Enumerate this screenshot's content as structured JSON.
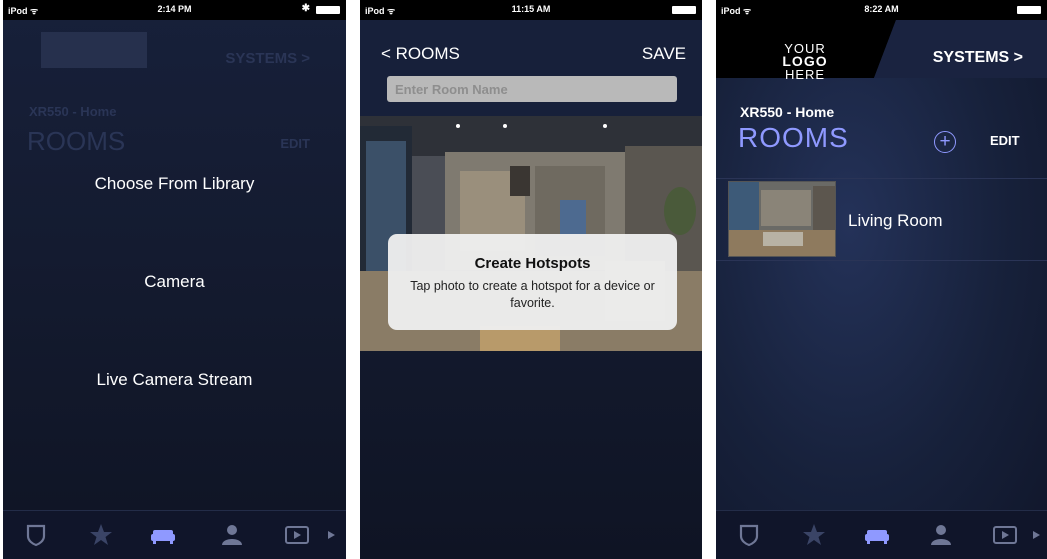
{
  "colors": {
    "accent": "#8f99ff",
    "background": "#17203a",
    "tabbar": "#10152a"
  },
  "tabs": [
    {
      "icon": "shield-icon"
    },
    {
      "icon": "star-icon"
    },
    {
      "icon": "sofa-icon"
    },
    {
      "icon": "user-icon"
    },
    {
      "icon": "video-icon"
    }
  ],
  "panel1": {
    "status": {
      "carrier": "iPod ᯤ",
      "time": "2:14 PM"
    },
    "background": {
      "systems": "SYSTEMS >",
      "system_name": "XR550 - Home",
      "rooms": "ROOMS",
      "edit": "EDIT"
    },
    "menu": {
      "library": "Choose From Library",
      "camera": "Camera",
      "live": "Live Camera Stream"
    }
  },
  "panel2": {
    "status": {
      "carrier": "iPod ᯤ",
      "time": "11:15 AM"
    },
    "nav": {
      "back": "< ROOMS",
      "save": "SAVE"
    },
    "room_name": {
      "placeholder": "Enter Room Name"
    },
    "alert": {
      "title": "Create Hotspots",
      "message": "Tap photo to create a hotspot for a device or favorite."
    }
  },
  "panel3": {
    "status": {
      "carrier": "iPod ᯤ",
      "time": "8:22 AM"
    },
    "logo": {
      "line1": "YOUR",
      "line2": "LOGO",
      "line3": "HERE"
    },
    "systems": "SYSTEMS >",
    "system_name": "XR550 - Home",
    "title": "ROOMS",
    "add": "+",
    "edit": "EDIT",
    "rooms": [
      {
        "name": "Living Room"
      }
    ]
  }
}
